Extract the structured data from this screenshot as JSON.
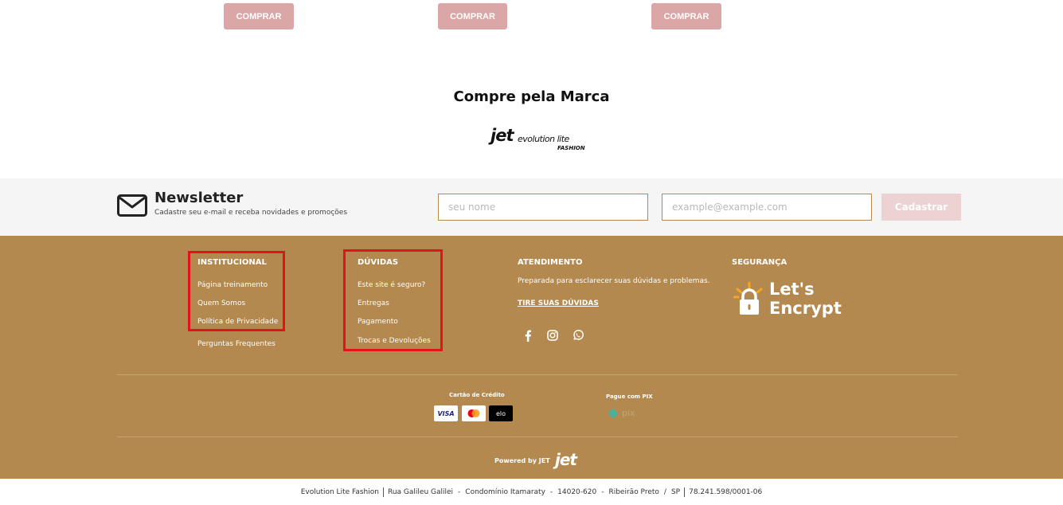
{
  "products": {
    "buy_label": "COMPRAR"
  },
  "brands": {
    "title": "Compre pela Marca",
    "logo": {
      "word": "jet",
      "line1": "evolution lite",
      "line2": "FASHION"
    }
  },
  "newsletter": {
    "title": "Newsletter",
    "subtitle": "Cadastre seu e-mail e receba novidades e promoções",
    "name_placeholder": "seu nome",
    "email_placeholder": "example@example.com",
    "submit_label": "Cadastrar"
  },
  "footer": {
    "institucional": {
      "title": "INSTITUCIONAL",
      "links": [
        "Página treinamento",
        "Quem Somos",
        "Política de Privacidade",
        "Perguntas Frequentes"
      ]
    },
    "duvidas": {
      "title": "DÚVIDAS",
      "links": [
        "Este site é seguro?",
        "Entregas",
        "Pagamento",
        "Trocas e Devoluções"
      ]
    },
    "atendimento": {
      "title": "ATENDIMENTO",
      "text": "Preparada para esclarecer suas dúvidas e problemas.",
      "link": "TIRE SUAS DÚVIDAS",
      "social_icons": [
        "facebook-icon",
        "instagram-icon",
        "whatsapp-icon"
      ]
    },
    "seguranca": {
      "title": "SEGURANÇA",
      "badge_line1": "Let's",
      "badge_line2": "Encrypt"
    },
    "payment": {
      "credit_label": "Cartão de Crédito",
      "cards": [
        "VISA",
        "mastercard",
        "elo"
      ],
      "pix_label": "Pague com PIX",
      "pix_text": "pix"
    },
    "powered": {
      "label": "Powered by JET",
      "logo_word": "jet"
    }
  },
  "bottom_bar": {
    "items": [
      "Evolution Lite Fashion",
      "Rua Galileu Galilei",
      "Condomínio Itamaraty",
      "14020-620",
      "Ribeirão Preto",
      "SP",
      "78.241.598/0001-06"
    ]
  },
  "colors": {
    "footer_bg": "#b3894f",
    "buy_button": "#dba6a6",
    "highlight_box": "#e0141a",
    "newsletter_bg": "#f5f5f5"
  }
}
